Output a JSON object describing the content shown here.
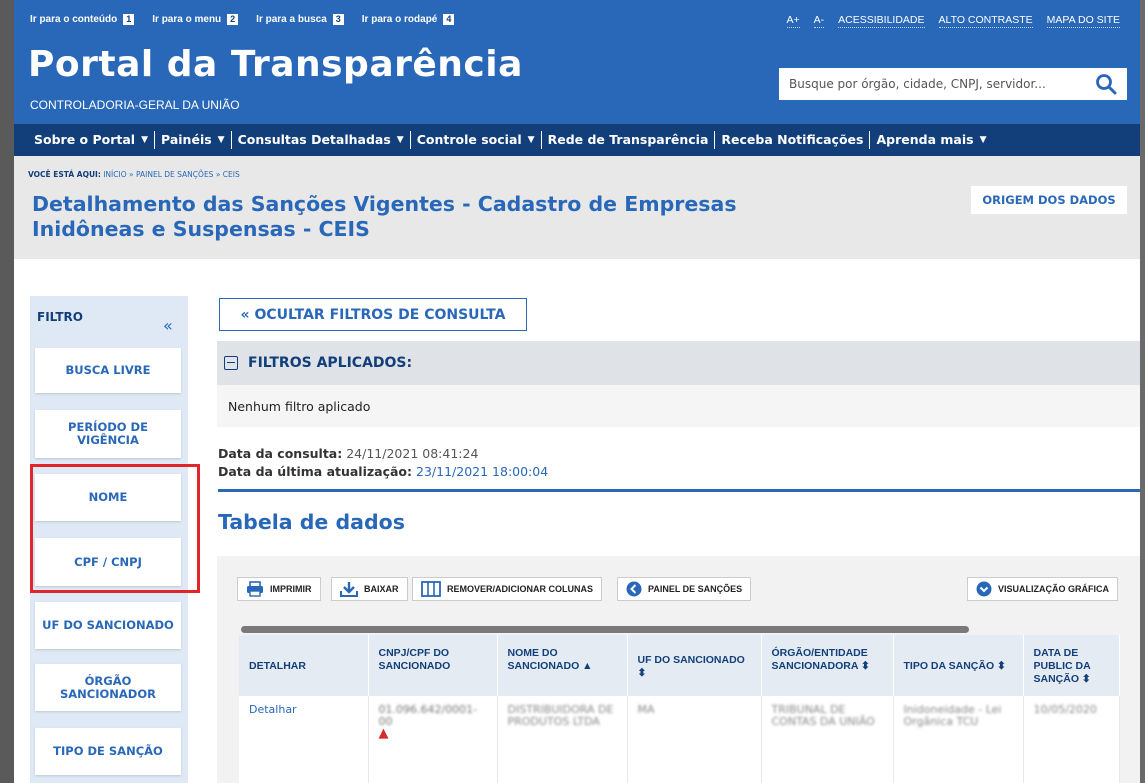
{
  "header": {
    "access_links": [
      {
        "label": "Ir para o conteúdo",
        "key": "1"
      },
      {
        "label": "Ir para o menu",
        "key": "2"
      },
      {
        "label": "Ir para a busca",
        "key": "3"
      },
      {
        "label": "Ir para o rodapé",
        "key": "4"
      }
    ],
    "top_right": [
      "A+",
      "A-",
      "ACESSIBILIDADE",
      "ALTO CONTRASTE",
      "MAPA DO SITE"
    ],
    "title": "Portal da Transparência",
    "subtitle": "CONTROLADORIA-GERAL DA UNIÃO",
    "search_placeholder": "Busque por órgão, cidade, CNPJ, servidor..."
  },
  "nav": [
    {
      "label": "Sobre o Portal",
      "caret": "▼"
    },
    {
      "label": "Painéis",
      "caret": "▼"
    },
    {
      "label": "Consultas Detalhadas",
      "caret": "▼"
    },
    {
      "label": "Controle social",
      "caret": "▼"
    },
    {
      "label": "Rede de Transparência",
      "caret": ""
    },
    {
      "label": "Receba Notificações",
      "caret": ""
    },
    {
      "label": "Aprenda mais",
      "caret": "▼"
    }
  ],
  "breadcrumb": {
    "prefix": "VOCÊ ESTÁ AQUI:",
    "path": "INÍCIO » PAINEL DE SANÇÕES » CEIS"
  },
  "page_title": "Detalhamento das Sanções Vigentes - Cadastro de Empresas Inidôneas e Suspensas - CEIS",
  "origem_button": "ORIGEM DOS DADOS",
  "sidebar": {
    "label": "FILTRO",
    "collapse_glyph": "«",
    "buttons": [
      "BUSCA LIVRE",
      "PERÍODO DE VIGÊNCIA",
      "NOME",
      "CPF / CNPJ",
      "UF DO SANCIONADO",
      "ÓRGÃO SANCIONADOR",
      "TIPO DE SANÇÃO"
    ]
  },
  "main": {
    "hide_filters": "« OCULTAR FILTROS DE CONSULTA",
    "applied_filters_title": "FILTROS APLICADOS:",
    "no_filter": "Nenhum filtro aplicado",
    "consult_date_label": "Data da consulta:",
    "consult_date_value": "24/11/2021 08:41:24",
    "update_date_label": "Data da última atualização:",
    "update_date_value": "23/11/2021 18:00:04",
    "table_title": "Tabela de dados"
  },
  "toolbar": {
    "print": "IMPRIMIR",
    "download": "BAIXAR",
    "columns": "REMOVER/ADICIONAR COLUNAS",
    "panel": "PAINEL DE SANÇÕES",
    "chart_view": "VISUALIZAÇÃO GRÁFICA"
  },
  "table": {
    "headers": [
      "DETALHAR",
      "CNPJ/CPF DO SANCIONADO",
      "NOME DO SANCIONADO ▲",
      "UF DO SANCIONADO ⬍",
      "ÓRGÃO/ENTIDADE SANCIONADORA ⬍",
      "TIPO DA SANÇÃO ⬍",
      "DATA DE PUBLIC DA SANÇÃO ⬍"
    ],
    "row": {
      "detail_link": "Detalhar",
      "cnpj": "01.096.642/0001-00",
      "warning_glyph": "▲",
      "name": "DISTRIBUIDORA DE PRODUTOS LTDA",
      "uf": "MA",
      "orgao": "TRIBUNAL DE CONTAS DA UNIÃO",
      "tipo": "Inidoneidade - Lei Orgânica TCU",
      "data": "10/05/2020"
    }
  },
  "colors": {
    "header_blue": "#2968b8",
    "nav_dark": "#123f7a",
    "highlight_red": "#e0252b",
    "sidebar_bg": "#dfe9f5"
  }
}
